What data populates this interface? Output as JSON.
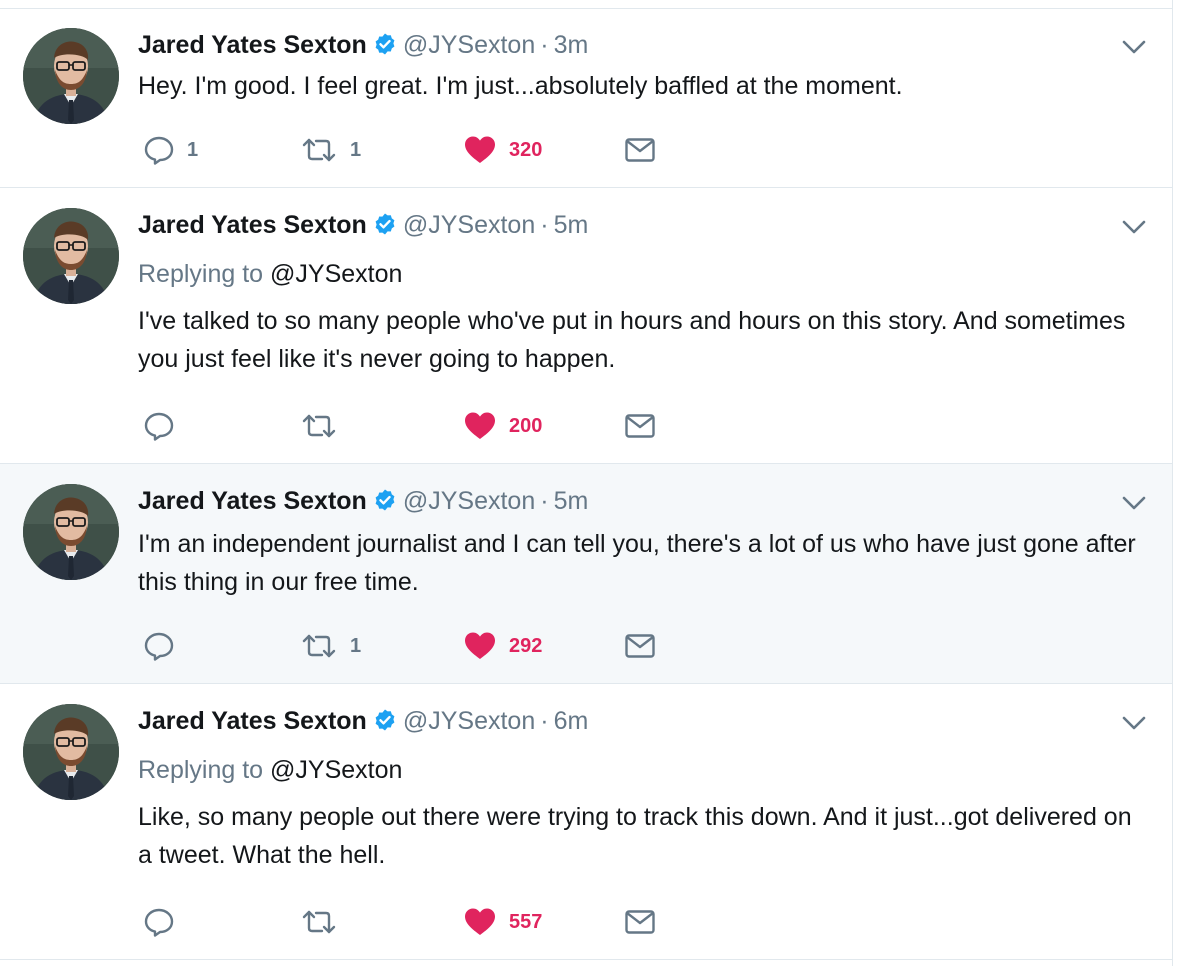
{
  "accent": "#1da1f2",
  "like_color": "#e0245e",
  "muted": "#657786",
  "tweets": [
    {
      "name": "Jared Yates Sexton",
      "handle": "@JYSexton",
      "separator": "·",
      "time": "3m",
      "replying_label": "",
      "replying_to": "",
      "text": "Hey. I'm good. I feel great. I'm just...absolutely baffled at the moment.",
      "reply_count": "1",
      "retweet_count": "1",
      "like_count": "320",
      "highlighted": false
    },
    {
      "name": "Jared Yates Sexton",
      "handle": "@JYSexton",
      "separator": "·",
      "time": "5m",
      "replying_label": "Replying to",
      "replying_to": "@JYSexton",
      "text": "I've talked to so many people who've put in hours and hours on this story. And sometimes you just feel like it's never going to happen.",
      "reply_count": "",
      "retweet_count": "",
      "like_count": "200",
      "highlighted": false
    },
    {
      "name": "Jared Yates Sexton",
      "handle": "@JYSexton",
      "separator": "·",
      "time": "5m",
      "replying_label": "",
      "replying_to": "",
      "text": "I'm an independent journalist and I can tell you, there's a lot of us who have just gone after this thing in our free time.",
      "reply_count": "",
      "retweet_count": "1",
      "like_count": "292",
      "highlighted": true
    },
    {
      "name": "Jared Yates Sexton",
      "handle": "@JYSexton",
      "separator": "·",
      "time": "6m",
      "replying_label": "Replying to",
      "replying_to": "@JYSexton",
      "text": "Like, so many people out there were trying to track this down. And it just...got delivered on a tweet. What the hell.",
      "reply_count": "",
      "retweet_count": "",
      "like_count": "557",
      "highlighted": false
    }
  ],
  "icons": {
    "reply": "reply-icon",
    "retweet": "retweet-icon",
    "like": "heart-icon",
    "dm": "envelope-icon",
    "verified": "verified-badge-icon",
    "menu": "chevron-down-icon"
  }
}
